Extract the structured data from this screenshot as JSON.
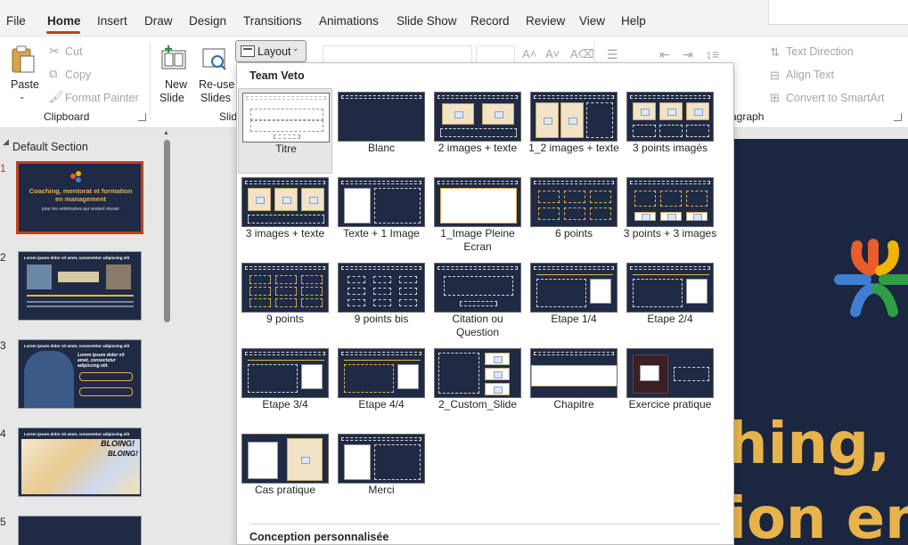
{
  "menu": {
    "file": "File",
    "home": "Home",
    "insert": "Insert",
    "draw": "Draw",
    "design": "Design",
    "transitions": "Transitions",
    "animations": "Animations",
    "slideshow": "Slide Show",
    "record": "Record",
    "review": "Review",
    "view": "View",
    "help": "Help"
  },
  "ribbon": {
    "paste": "Paste",
    "cut": "Cut",
    "copy": "Copy",
    "format_painter": "Format Painter",
    "clipboard": "Clipboard",
    "new_slide_1": "New",
    "new_slide_2": "Slide",
    "reuse_1": "Re-use",
    "reuse_2": "Slides",
    "slides_group": "Slid",
    "layout": "Layout",
    "text_direction": "Text Direction",
    "align_text": "Align Text",
    "convert_smartart": "Convert to SmartArt",
    "paragraph_group": "agraph"
  },
  "slides_pane": {
    "section": "Default Section",
    "numbers": [
      "1",
      "2",
      "3",
      "4",
      "5"
    ],
    "slide1_title": "Coaching, mentorat et formation en management",
    "slide1_sub": "pour les vétérinaires qui veulent réussir",
    "slide_header": "Lorem ipsum dolor sit amet, consectetur adipiscing elit",
    "slide3_text": "Lorem ipsum dolor sit amet, consectetur adipiscing elit.",
    "slide4_text1": "BLOING!",
    "slide4_text2": "BLOING!"
  },
  "slide_canvas": {
    "line1": "hing, r",
    "line2": "ion en"
  },
  "layout_dropdown": {
    "theme_name": "Team Veto",
    "section2": "Conception personnalisée",
    "layouts": [
      "Titre",
      "Blanc",
      "2 images + texte",
      "1_2 images + texte",
      "3 points imagés",
      "3 images + texte",
      "Texte + 1 Image",
      "1_Image Pleine Ecran",
      "6 points",
      "3 points + 3 images",
      "9 points",
      "9 points bis",
      "Citation ou Question",
      "Etape 1/4",
      "Etape 2/4",
      "Etape 3/4",
      "Etape 4/4",
      "2_Custom_Slide",
      "Chapitre",
      "Exercice pratique",
      "Cas pratique",
      "Merci"
    ],
    "selected": "Titre"
  },
  "colors": {
    "accent": "#c43e1c",
    "slide_bg": "#1b2640",
    "title_gold": "#e8b34a"
  }
}
